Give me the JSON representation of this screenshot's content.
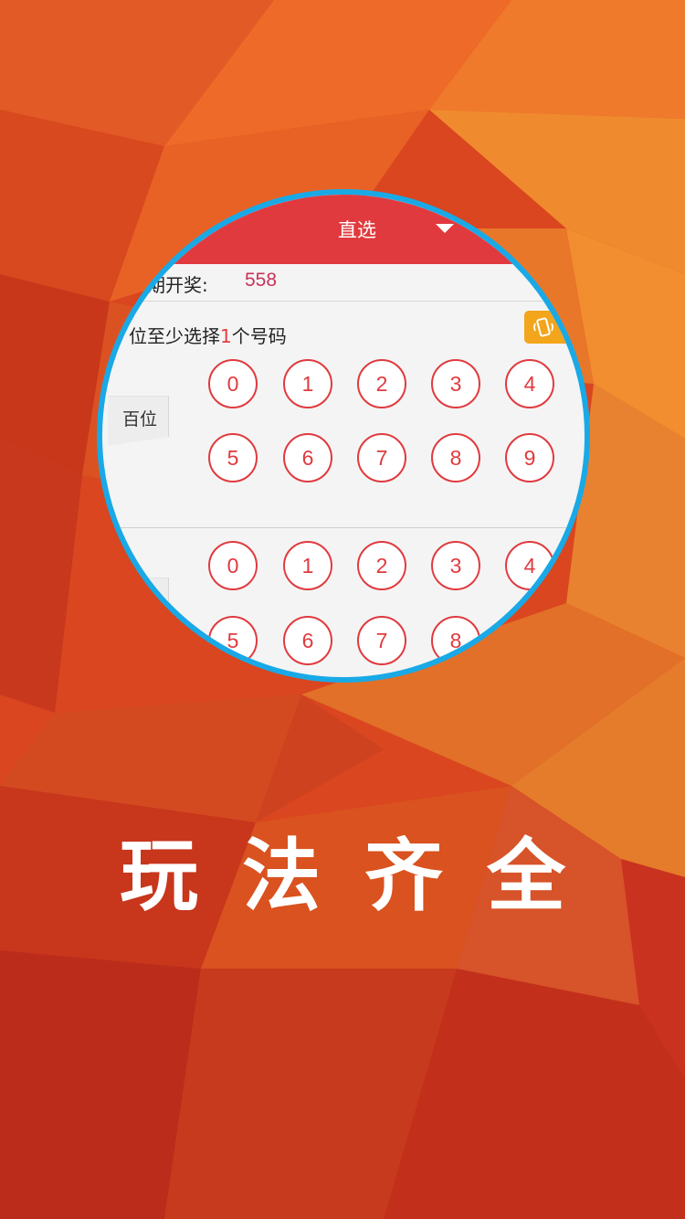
{
  "colors": {
    "background": "#d8451f",
    "lens_border": "#19a9e6",
    "header": "#e03a3e",
    "ball": "#e03a3e",
    "last_value": "#c8325a",
    "shake_button": "#f3a51b"
  },
  "header": {
    "title": "直选",
    "dropdown_icon": "caret-down-icon"
  },
  "last_draw": {
    "label": "期开奖:",
    "value": "558"
  },
  "hint": {
    "prefix": "位至少选择",
    "count": "1",
    "suffix": "个号码"
  },
  "shake_button": {
    "icon": "shake-phone-icon"
  },
  "hundreds_row": {
    "label": "百位",
    "numbers": [
      "0",
      "1",
      "2",
      "3",
      "4",
      "5",
      "6",
      "7",
      "8",
      "9"
    ]
  },
  "tens_row": {
    "numbers": [
      "0",
      "1",
      "2",
      "3",
      "4",
      "5",
      "6",
      "7",
      "8"
    ]
  },
  "slogan": "玩法齐全"
}
